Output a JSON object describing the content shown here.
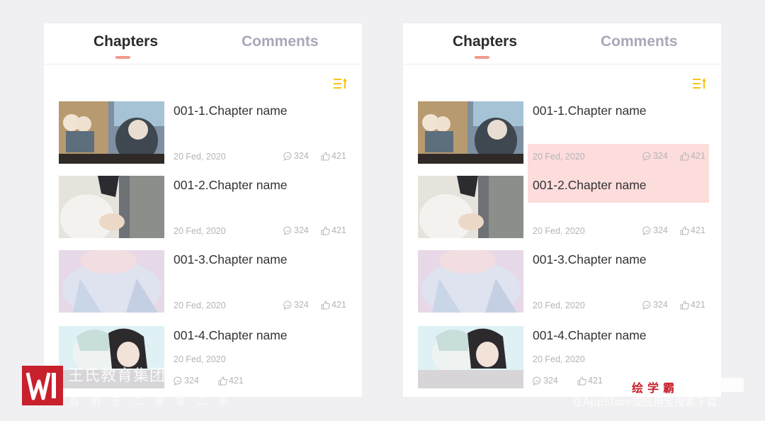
{
  "tabs": {
    "chapters": "Chapters",
    "comments": "Comments"
  },
  "chapters": [
    {
      "title": "001-1.Chapter name",
      "date": "20 Fed, 2020",
      "comments": "324",
      "likes": "421"
    },
    {
      "title": "001-2.Chapter name",
      "date": "20 Fed, 2020",
      "comments": "324",
      "likes": "421"
    },
    {
      "title": "001-3.Chapter name",
      "date": "20 Fed, 2020",
      "comments": "324",
      "likes": "421"
    },
    {
      "title": "001-4.Chapter name",
      "date": "20 Fed, 2020",
      "comments": "324",
      "likes": "421"
    }
  ],
  "icons": {
    "sort": "sort-order-icon",
    "comment": "comment-bubble-icon",
    "like": "thumbs-up-icon"
  },
  "colors": {
    "tab_underline": "#f39a8e",
    "sort_icon": "#f5c518",
    "highlight": "#fddcdc",
    "watermark_red": "#c8202d"
  },
  "watermark": {
    "org": "王氏教育集团",
    "slogan": "自创于二零零二年",
    "brand": "绘学霸",
    "app": "在AppStore或应用宝搜索下载"
  }
}
